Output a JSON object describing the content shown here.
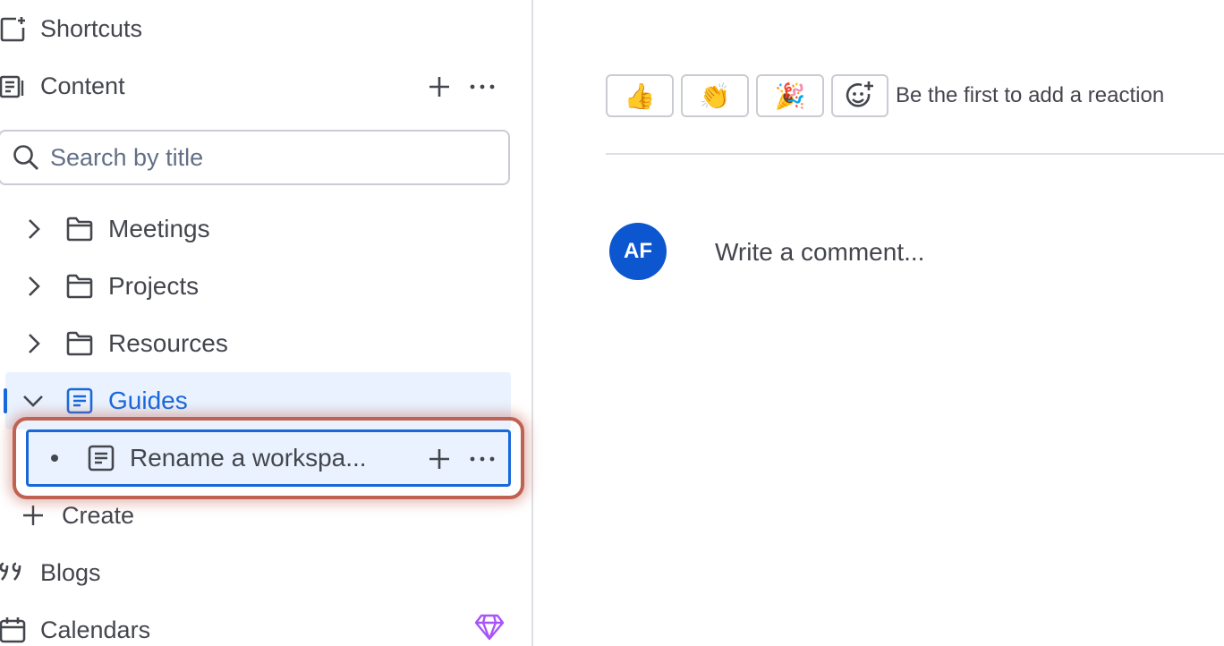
{
  "sidebar": {
    "shortcuts_label": "Shortcuts",
    "content_label": "Content",
    "search_placeholder": "Search by title",
    "tree": {
      "meetings": "Meetings",
      "projects": "Projects",
      "resources": "Resources",
      "guides": "Guides",
      "child_page": "Rename a workspa..."
    },
    "create_label": "Create",
    "blogs_label": "Blogs",
    "calendars_label": "Calendars"
  },
  "reactions": {
    "thumbs_up": "👍",
    "clap": "👏",
    "party": "🎉",
    "hint": "Be the first to add a reaction"
  },
  "comment": {
    "avatar_initials": "AF",
    "placeholder": "Write a comment..."
  },
  "colors": {
    "accent": "#1868DB",
    "highlight": "#C06252",
    "avatar_bg": "#0C56D0",
    "selected_bg": "#E9F2FE",
    "premium_purple": "#A855F7"
  }
}
